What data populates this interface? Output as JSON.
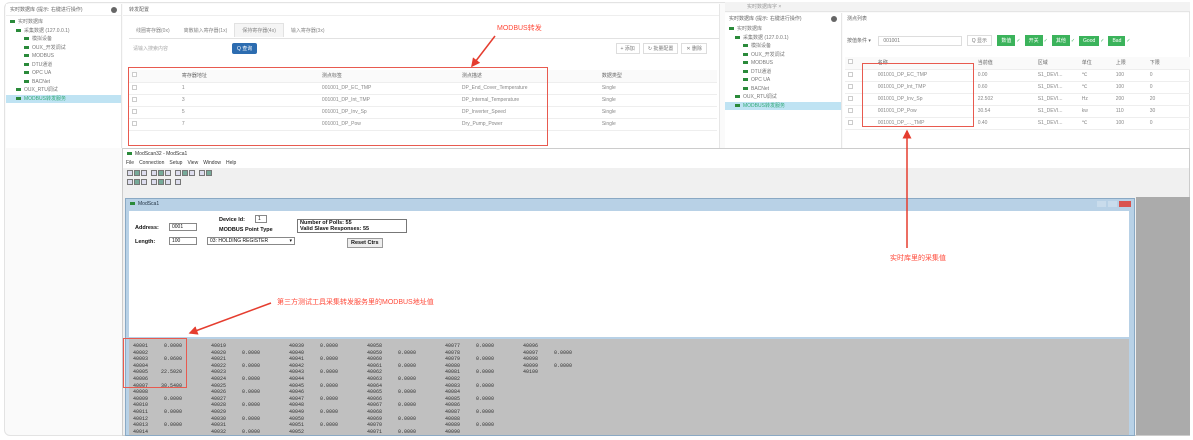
{
  "left_app": {
    "sidebar_title": "实时数据库 (提示: 右键进行操作)",
    "tree": [
      "实时数据库",
      "采集数据 (127.0.0.1)",
      "模拟设备",
      "OUX_开发调试",
      "MODBUS",
      "DTU通道",
      "OPC UA",
      "BACNet",
      "OUX_RTU调试",
      "MODBUS转发服务"
    ],
    "header": "转发配置",
    "tabs": [
      "线圈寄存器(0x)",
      "离散输入寄存器(1x)",
      "保持寄存器(4x)",
      "输入寄存器(3x)"
    ],
    "search_placeholder": "请输入搜索内容",
    "search_btn": "Q 查询",
    "actions": [
      "+ 添加",
      "↻ 批量配置",
      "✕ 删除"
    ],
    "columns": [
      "寄存器地址",
      "测点标签",
      "测点描述",
      "数据类型"
    ],
    "rows": [
      [
        "1",
        "001001_DP_EC_TMP",
        "DP_End_Cover_Temperature",
        "Single"
      ],
      [
        "3",
        "001001_DP_Int_TMP",
        "DP_Internal_Temperature",
        "Single"
      ],
      [
        "5",
        "001001_DP_Inv_Sp",
        "DP_Inverter_Speed",
        "Single"
      ],
      [
        "7",
        "001001_DP_Pow",
        "Dry_Pump_Power",
        "Single"
      ]
    ]
  },
  "right_app": {
    "tab": "实时数据库字 ×",
    "sidebar_title": "实时数据库 (提示: 右键进行操作)",
    "tree": [
      "实时数据库",
      "采集数据 (127.0.0.1)",
      "模拟设备",
      "OUX_开发调试",
      "MODBUS",
      "DTU通道",
      "OPC UA",
      "BACNet",
      "OUX_RTU调试",
      "MODBUS转发服务"
    ],
    "header": "测点列表",
    "filter_select": "按值条件",
    "filter_value": "001001",
    "show_btn": "Q 显示",
    "toggles": [
      "数值",
      "开关",
      "其他",
      "Good",
      "Bad"
    ],
    "columns": [
      "名称",
      "当前值",
      "区域",
      "单位",
      "上限",
      "下限"
    ],
    "rows": [
      [
        "001001_DP_EC_TMP",
        "0.00",
        "S1_DEVI...",
        "℃",
        "100",
        "0"
      ],
      [
        "001001_DP_Int_TMP",
        "0.60",
        "S1_DEVI...",
        "℃",
        "100",
        "0"
      ],
      [
        "001001_DP_Inv_Sp",
        "22.502",
        "S1_DEVI...",
        "Hz",
        "200",
        "20"
      ],
      [
        "001001_DP_Pow",
        "30.54",
        "S1_DEVI...",
        "kw",
        "110",
        "30"
      ],
      [
        "001001_DP_..._TMP",
        "0.40",
        "S1_DEVI...",
        "℃",
        "100",
        "0"
      ]
    ]
  },
  "modscan": {
    "title": "ModScan32 - ModSca1",
    "menu": [
      "File",
      "Connection",
      "Setup",
      "View",
      "Window",
      "Help"
    ],
    "child_title": "ModSca1",
    "address_label": "Address:",
    "address": "0001",
    "length_label": "Length:",
    "length": "100",
    "device_label": "Device Id:",
    "device": "1",
    "point_type_label": "MODBUS Point Type",
    "point_type": "03: HOLDING REGISTER",
    "polls": "Number of Polls: 55",
    "valid": "Valid Slave Responses: 55",
    "reset": "Reset Ctrs",
    "grid": [
      [
        [
          "40001",
          "0.0000"
        ],
        [
          "40002",
          ""
        ],
        [
          "40003",
          "0.0600"
        ],
        [
          "40004",
          ""
        ],
        [
          "40005",
          "22.5020"
        ],
        [
          "40006",
          ""
        ],
        [
          "40007",
          "30.5400"
        ],
        [
          "40008",
          ""
        ],
        [
          "40009",
          "0.0000"
        ],
        [
          "40010",
          ""
        ],
        [
          "40011",
          "0.0000"
        ],
        [
          "40012",
          ""
        ],
        [
          "40013",
          "0.0000"
        ],
        [
          "40014",
          ""
        ]
      ],
      [
        [
          "40019",
          ""
        ],
        [
          "40020",
          "0.0000"
        ],
        [
          "40021",
          ""
        ],
        [
          "40022",
          "0.0000"
        ],
        [
          "40023",
          ""
        ],
        [
          "40024",
          "0.0000"
        ],
        [
          "40025",
          ""
        ],
        [
          "40026",
          "0.0000"
        ],
        [
          "40027",
          ""
        ],
        [
          "40028",
          "0.0000"
        ],
        [
          "40029",
          ""
        ],
        [
          "40030",
          "0.0000"
        ],
        [
          "40031",
          ""
        ],
        [
          "40032",
          "0.0000"
        ]
      ],
      [
        [
          "40039",
          "0.0000"
        ],
        [
          "40040",
          ""
        ],
        [
          "40041",
          "0.0000"
        ],
        [
          "40042",
          ""
        ],
        [
          "40043",
          "0.0000"
        ],
        [
          "40044",
          ""
        ],
        [
          "40045",
          "0.0000"
        ],
        [
          "40046",
          ""
        ],
        [
          "40047",
          "0.0000"
        ],
        [
          "40048",
          ""
        ],
        [
          "40049",
          "0.0000"
        ],
        [
          "40050",
          ""
        ],
        [
          "40051",
          "0.0000"
        ],
        [
          "40052",
          ""
        ]
      ],
      [
        [
          "40058",
          ""
        ],
        [
          "40059",
          "0.0000"
        ],
        [
          "40060",
          ""
        ],
        [
          "40061",
          "0.0000"
        ],
        [
          "40062",
          ""
        ],
        [
          "40063",
          "0.0000"
        ],
        [
          "40064",
          ""
        ],
        [
          "40065",
          "0.0000"
        ],
        [
          "40066",
          ""
        ],
        [
          "40067",
          "0.0000"
        ],
        [
          "40068",
          ""
        ],
        [
          "40069",
          "0.0000"
        ],
        [
          "40070",
          ""
        ],
        [
          "40071",
          "0.0000"
        ]
      ],
      [
        [
          "40077",
          "0.0000"
        ],
        [
          "40078",
          ""
        ],
        [
          "40079",
          "0.0000"
        ],
        [
          "40080",
          ""
        ],
        [
          "40081",
          "0.0000"
        ],
        [
          "40082",
          ""
        ],
        [
          "40083",
          "0.0000"
        ],
        [
          "40084",
          ""
        ],
        [
          "40085",
          "0.0000"
        ],
        [
          "40086",
          ""
        ],
        [
          "40087",
          "0.0000"
        ],
        [
          "40088",
          ""
        ],
        [
          "40089",
          "0.0000"
        ],
        [
          "40090",
          ""
        ]
      ],
      [
        [
          "40096",
          ""
        ],
        [
          "40097",
          "0.0000"
        ],
        [
          "40098",
          ""
        ],
        [
          "40099",
          "0.0000"
        ],
        [
          "40100",
          ""
        ]
      ]
    ]
  },
  "annotations": {
    "modbus_forward": "MODBUS转发",
    "realtime_values": "实时库里的采集值",
    "third_party": "第三方测试工具采集转发服务里的MODBUS地址值"
  },
  "colors": {
    "annotation": "#ff4a3a",
    "accent": "#2c6cb0",
    "good": "#3bb35b"
  }
}
